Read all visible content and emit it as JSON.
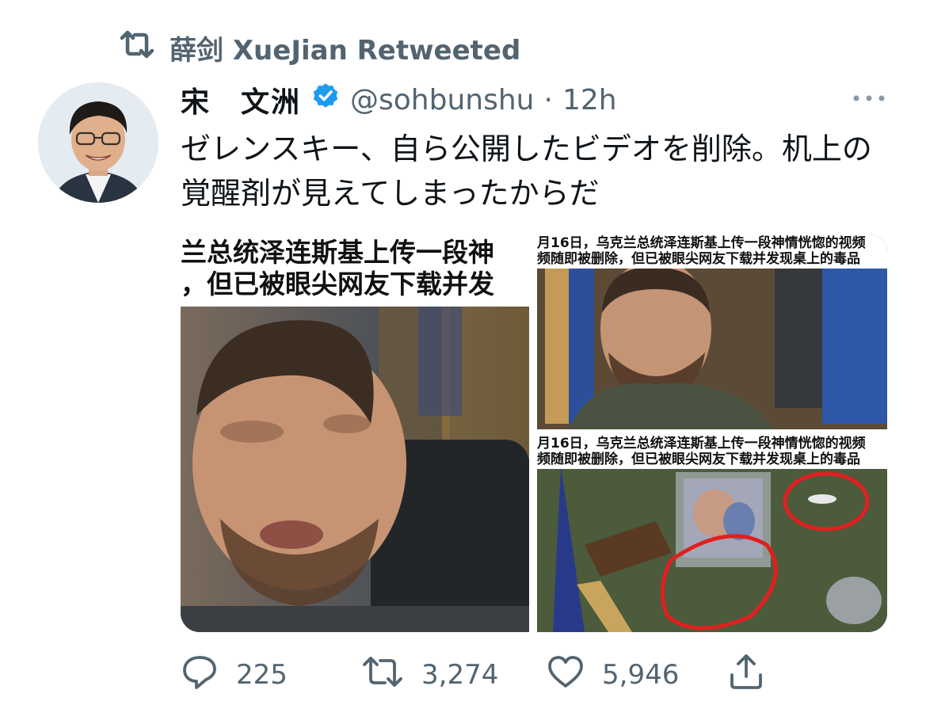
{
  "retweet": {
    "label": "薛剑 XueJian Retweeted",
    "icon": "retweet-icon"
  },
  "author": {
    "name": "宋　文洲",
    "verified": true,
    "verified_color": "#1d9bf0",
    "handle": "@sohbunshu",
    "separator": "·",
    "time": "12h"
  },
  "tweet": {
    "text": "ゼレンスキー、自ら公開したビデオを削除。机上の覚醒剤が見えてしまったからだ"
  },
  "media": {
    "left": {
      "caption_line1": "兰总统泽连斯基上传一段神",
      "caption_line2": "，但已被眼尖网友下载并发"
    },
    "top_right": {
      "caption_line1": "月16日，乌克兰总统泽连斯基上传一段神情恍惚的视频",
      "caption_line2": "频随即被删除，但已被眼尖网友下载并发现桌上的毒品"
    },
    "bottom_right": {
      "caption_line1": "月16日，乌克兰总统泽连斯基上传一段神情恍惚的视频",
      "caption_line2": "频随即被删除，但已被眼尖网友下载并发现桌上的毒品"
    }
  },
  "actions": {
    "reply_count": "225",
    "retweet_count": "3,274",
    "like_count": "5,946"
  },
  "colors": {
    "text_primary": "#0f1419",
    "text_secondary": "#536471",
    "accent": "#1d9bf0"
  }
}
